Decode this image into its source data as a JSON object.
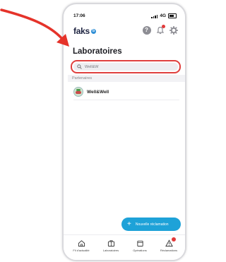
{
  "status": {
    "time": "17:06",
    "network": "4G"
  },
  "header": {
    "brand": "faks",
    "brand_mark": "b"
  },
  "page": {
    "title": "Laboratoires"
  },
  "search": {
    "value": "Well&W"
  },
  "section": {
    "title": "Partenaires"
  },
  "labs": [
    {
      "name": "Well&Well"
    }
  ],
  "fab": {
    "plus": "+",
    "label": "Nouvelle réclamation"
  },
  "tabs": [
    {
      "label": "Fil d'actualité",
      "icon": "home-icon"
    },
    {
      "label": "Laboratoires",
      "icon": "briefcase-icon"
    },
    {
      "label": "Opérations",
      "icon": "calendar-icon"
    },
    {
      "label": "Réclamations",
      "icon": "warning-icon"
    }
  ],
  "colors": {
    "accent": "#1ea2d8",
    "highlight": "#e0403e",
    "brand_text": "#1d2340"
  }
}
